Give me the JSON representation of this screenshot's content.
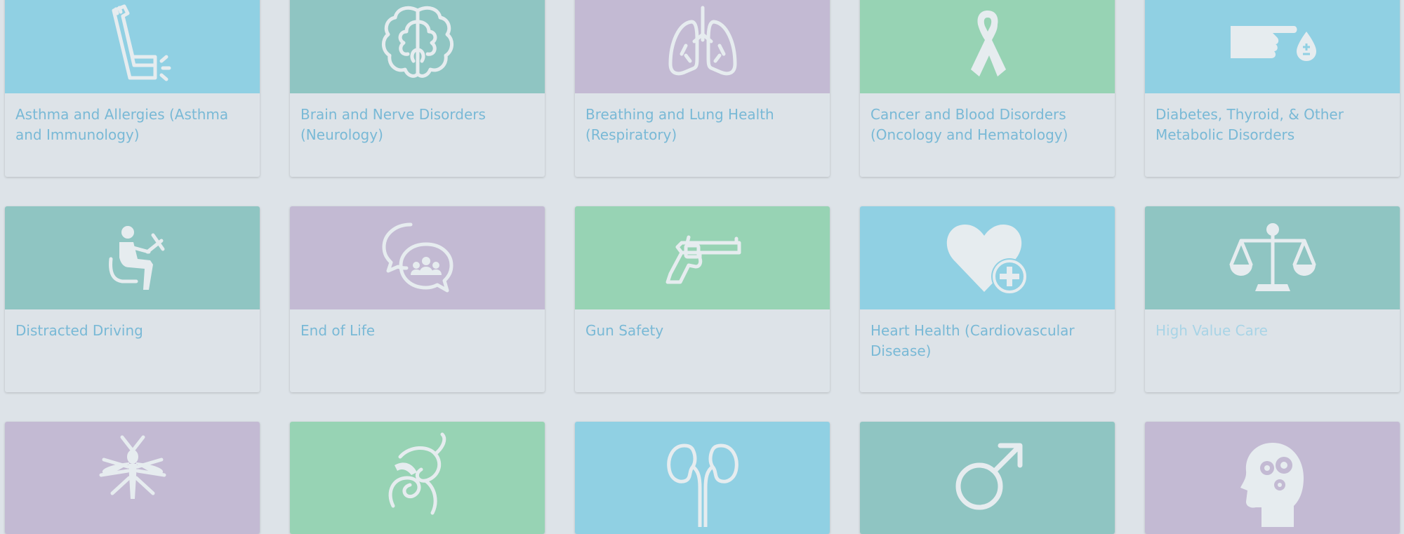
{
  "colors": {
    "blue": "#90d0e3",
    "teal": "#8fc5c2",
    "purple": "#c3bad3",
    "green": "#97d3b4",
    "label": "#79b9d6",
    "background": "#dde3e8"
  },
  "topics": [
    {
      "label": "Asthma and Allergies (Asthma and Immunology)",
      "icon": "inhaler-icon",
      "color": "blue"
    },
    {
      "label": "Brain and Nerve Disorders (Neurology)",
      "icon": "brain-icon",
      "color": "teal"
    },
    {
      "label": "Breathing and Lung Health (Respiratory)",
      "icon": "lungs-icon",
      "color": "purple"
    },
    {
      "label": "Cancer and Blood Disorders (Oncology and Hematology)",
      "icon": "ribbon-icon",
      "color": "green"
    },
    {
      "label": "Diabetes, Thyroid, & Other Metabolic Disorders",
      "icon": "finger-prick-icon",
      "color": "blue"
    },
    {
      "label": "Distracted Driving",
      "icon": "texting-driver-icon",
      "color": "teal"
    },
    {
      "label": "End of Life",
      "icon": "conversation-icon",
      "color": "purple"
    },
    {
      "label": "Gun Safety",
      "icon": "revolver-icon",
      "color": "green"
    },
    {
      "label": "Heart Health (Cardiovascular Disease)",
      "icon": "heart-plus-icon",
      "color": "blue"
    },
    {
      "label": "High Value Care",
      "icon": "scales-icon",
      "color": "teal"
    },
    {
      "label": "",
      "icon": "mosquito-icon",
      "color": "purple"
    },
    {
      "label": "",
      "icon": "intestine-icon",
      "color": "green"
    },
    {
      "label": "",
      "icon": "kidneys-icon",
      "color": "blue"
    },
    {
      "label": "",
      "icon": "male-symbol-icon",
      "color": "teal"
    },
    {
      "label": "",
      "icon": "head-gears-icon",
      "color": "purple"
    }
  ]
}
